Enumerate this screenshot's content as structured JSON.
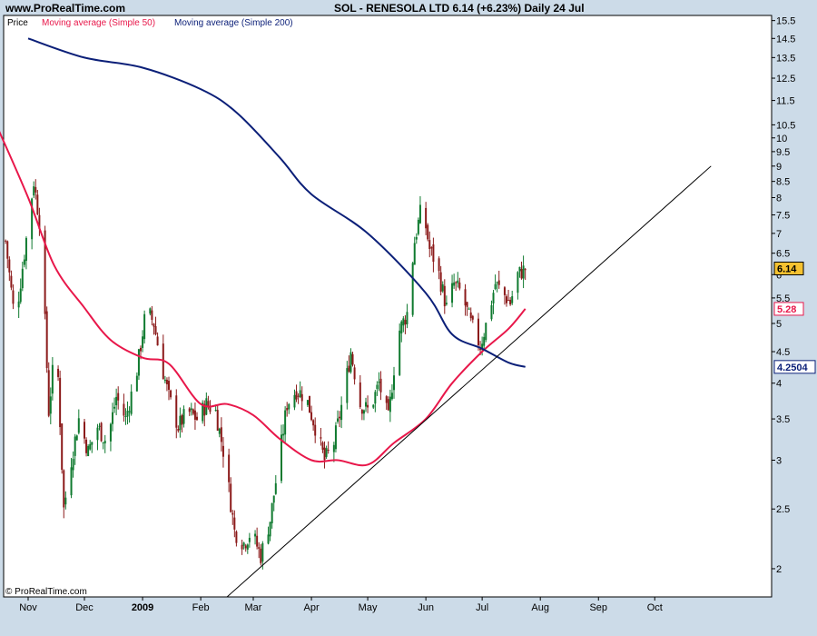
{
  "header": {
    "site": "www.ProRealTime.com",
    "title": "SOL - RENESOLA LTD    6.14 (+6.23%)    Daily  24 Jul"
  },
  "footer": {
    "copyright": "© ProRealTime.com"
  },
  "colors": {
    "background": "#ccdbe8",
    "plot": "#ffffff",
    "up_candle": "#0f7a2f",
    "down_candle": "#8b1a1a",
    "ma50": "#e8174a",
    "ma200": "#0b1f78",
    "trendline": "#000000"
  },
  "chart_data": {
    "type": "line",
    "scale": "log",
    "ylim": [
      1.8,
      15.8
    ],
    "legend": [
      {
        "name": "Price",
        "color": "#000000"
      },
      {
        "name": "Moving average (Simple 50)",
        "color": "#e8174a"
      },
      {
        "name": "Moving average (Simple 200)",
        "color": "#0b1f78"
      }
    ],
    "y_ticks": [
      15.5,
      14.5,
      13.5,
      12.5,
      11.5,
      10.5,
      10,
      9.5,
      9,
      8.5,
      8,
      7.5,
      7,
      6.5,
      6,
      5.5,
      5,
      4.5,
      4,
      3.5,
      3,
      2.5,
      2
    ],
    "x_months": [
      {
        "label": "Nov",
        "date": "2008-11-01"
      },
      {
        "label": "Dec",
        "date": "2008-12-01"
      },
      {
        "label": "2009",
        "date": "2009-01-01",
        "bold": true
      },
      {
        "label": "Feb",
        "date": "2009-02-01"
      },
      {
        "label": "Mar",
        "date": "2009-03-01"
      },
      {
        "label": "Apr",
        "date": "2009-04-01"
      },
      {
        "label": "May",
        "date": "2009-05-01"
      },
      {
        "label": "Jun",
        "date": "2009-06-01"
      },
      {
        "label": "Jul",
        "date": "2009-07-01"
      },
      {
        "label": "Aug",
        "date": "2009-08-01"
      },
      {
        "label": "Sep",
        "date": "2009-09-01"
      },
      {
        "label": "Oct",
        "date": "2009-10-01"
      }
    ],
    "price_close": {
      "dates": [
        "2008-10-20",
        "2008-10-25",
        "2008-10-30",
        "2008-11-04",
        "2008-11-08",
        "2008-11-12",
        "2008-11-16",
        "2008-11-20",
        "2008-11-24",
        "2008-11-28",
        "2008-12-03",
        "2008-12-08",
        "2008-12-13",
        "2008-12-18",
        "2008-12-23",
        "2008-12-29",
        "2009-01-03",
        "2009-01-07",
        "2009-01-11",
        "2009-01-15",
        "2009-01-20",
        "2009-01-25",
        "2009-01-30",
        "2009-02-04",
        "2009-02-09",
        "2009-02-14",
        "2009-02-19",
        "2009-02-24",
        "2009-02-28",
        "2009-03-05",
        "2009-03-10",
        "2009-03-14",
        "2009-03-19",
        "2009-03-24",
        "2009-03-29",
        "2009-04-03",
        "2009-04-08",
        "2009-04-13",
        "2009-04-18",
        "2009-04-22",
        "2009-04-27",
        "2009-05-02",
        "2009-05-07",
        "2009-05-12",
        "2009-05-17",
        "2009-05-22",
        "2009-05-26",
        "2009-05-30",
        "2009-06-03",
        "2009-06-07",
        "2009-06-12",
        "2009-06-16",
        "2009-06-20",
        "2009-06-25",
        "2009-06-30",
        "2009-07-04",
        "2009-07-08",
        "2009-07-12",
        "2009-07-16",
        "2009-07-20",
        "2009-07-24"
      ],
      "values": [
        6.8,
        5.0,
        6.5,
        8.5,
        7.0,
        3.6,
        4.8,
        2.5,
        3.0,
        3.5,
        3.1,
        3.4,
        3.2,
        3.8,
        3.5,
        4.2,
        5.3,
        5.0,
        4.3,
        3.8,
        3.4,
        3.6,
        3.5,
        3.7,
        3.6,
        3.0,
        2.3,
        2.2,
        2.3,
        2.1,
        2.4,
        2.9,
        3.7,
        3.9,
        3.8,
        3.4,
        3.0,
        3.2,
        3.8,
        4.5,
        3.7,
        3.6,
        4.0,
        3.5,
        4.8,
        5.2,
        6.8,
        7.8,
        6.6,
        6.2,
        5.3,
        5.8,
        5.6,
        5.0,
        4.6,
        5.1,
        5.8,
        5.6,
        5.4,
        6.0,
        6.14
      ]
    },
    "series": [
      {
        "name": "Moving average (Simple 50)",
        "dates": [
          "2008-10-01",
          "2008-10-15",
          "2008-11-01",
          "2008-11-15",
          "2008-12-01",
          "2008-12-15",
          "2009-01-01",
          "2009-01-15",
          "2009-02-01",
          "2009-02-15",
          "2009-03-01",
          "2009-03-15",
          "2009-04-01",
          "2009-04-15",
          "2009-05-01",
          "2009-05-15",
          "2009-06-01",
          "2009-06-15",
          "2009-07-01",
          "2009-07-15",
          "2009-07-24"
        ],
        "values": [
          13.0,
          10.5,
          8.0,
          6.2,
          5.3,
          4.7,
          4.4,
          4.3,
          3.7,
          3.7,
          3.55,
          3.25,
          3.0,
          3.0,
          2.95,
          3.2,
          3.5,
          4.0,
          4.5,
          4.9,
          5.28
        ]
      },
      {
        "name": "Moving average (Simple 200)",
        "dates": [
          "2008-11-01",
          "2008-12-01",
          "2009-01-01",
          "2009-02-01",
          "2009-02-20",
          "2009-03-15",
          "2009-04-01",
          "2009-05-01",
          "2009-06-01",
          "2009-06-15",
          "2009-07-01",
          "2009-07-15",
          "2009-07-24"
        ],
        "values": [
          14.5,
          13.5,
          13.0,
          12.0,
          11.0,
          9.3,
          8.1,
          7.0,
          5.6,
          4.8,
          4.55,
          4.32,
          4.2504
        ]
      }
    ],
    "trendline": {
      "dates": [
        "2009-02-15",
        "2009-10-31"
      ],
      "values": [
        1.8,
        9.0
      ]
    },
    "last_labels": [
      {
        "text": "6.14",
        "value": 6.14,
        "fill": "#f6c230",
        "text_color": "#000000",
        "border": "#000000"
      },
      {
        "text": "5.28",
        "value": 5.28,
        "fill": "#ffffff",
        "text_color": "#e8174a",
        "border": "#e8174a"
      },
      {
        "text": "4.2504",
        "value": 4.2504,
        "fill": "#ffffff",
        "text_color": "#0b1f78",
        "border": "#0b1f78"
      }
    ]
  }
}
